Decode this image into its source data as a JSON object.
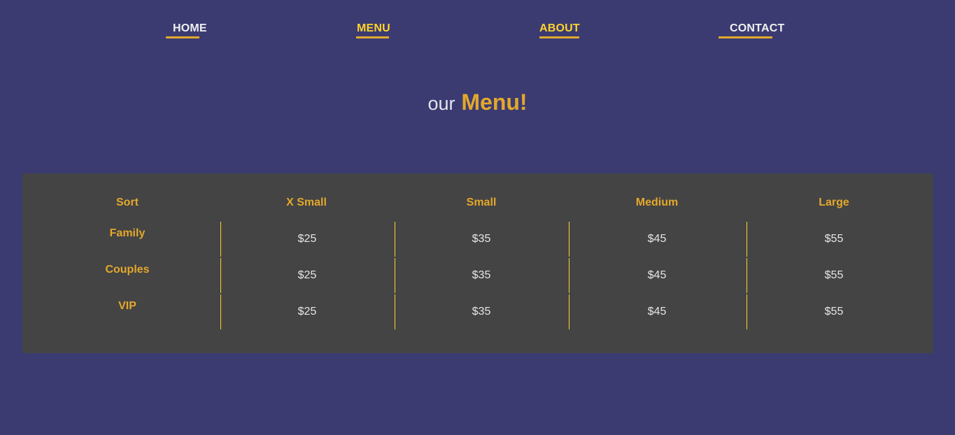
{
  "nav": {
    "items": [
      {
        "label": "HOME",
        "active": false
      },
      {
        "label": "MENU",
        "active": true
      },
      {
        "label": "ABOUT",
        "active": true
      },
      {
        "label": "CONTACT",
        "active": false
      }
    ]
  },
  "heading": {
    "prefix": "our",
    "title": "Menu!"
  },
  "table": {
    "headers": [
      "Sort",
      "X Small",
      "Small",
      "Medium",
      "Large"
    ],
    "rows": [
      {
        "label": "Family",
        "prices": [
          "$25",
          "$35",
          "$45",
          "$55"
        ]
      },
      {
        "label": "Couples",
        "prices": [
          "$25",
          "$35",
          "$45",
          "$55"
        ]
      },
      {
        "label": "VIP",
        "prices": [
          "$25",
          "$35",
          "$45",
          "$55"
        ]
      }
    ]
  },
  "colors": {
    "background": "#3b3b72",
    "panel": "#444444",
    "accent": "#e3a82b",
    "active_nav": "#ffd42a",
    "text_light": "#f0f0f0"
  }
}
